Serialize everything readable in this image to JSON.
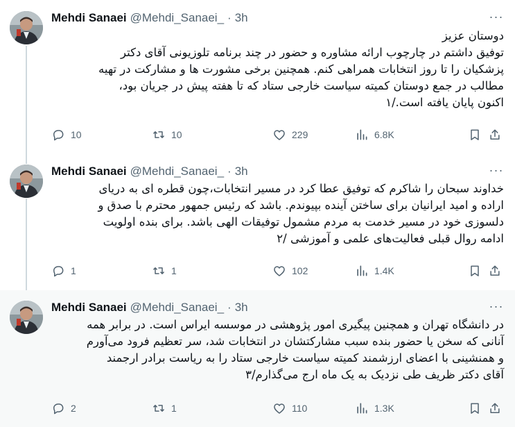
{
  "tweets": [
    {
      "author": {
        "name": "Mehdi Sanaei",
        "handle": "@Mehdi_Sanaei_",
        "separator": "·",
        "time": "3h"
      },
      "lines": [
        "دوستان عزیز",
        "توفیق داشتم در چارچوب ارائه مشاوره و حضور در چند برنامه تلوزیونی آقای دکتر",
        "پزشکیان را تا روز انتخابات همراهی کنم.  همچنین برخی مشورت ها و مشارکت در تهیه",
        "مطالب در جمع دوستان کمیته سیاست خارجی ستاد که  تا هفته پیش در جریان بود،",
        "اکنون پایان یافته است./۱"
      ],
      "stats": {
        "replies": "10",
        "retweets": "10",
        "likes": "229",
        "views": "6.8K"
      }
    },
    {
      "author": {
        "name": "Mehdi Sanaei",
        "handle": "@Mehdi_Sanaei_",
        "separator": "·",
        "time": "3h"
      },
      "lines": [
        "خداوند سبحان را شاکرم که توفیق عطا کرد در مسیر انتخابات،چون قطره ای به دریای",
        "اراده و امید ایرانیان برای ساختن آینده بپیوندم. باشد که رئیس جمهور محترم با صدق و",
        "دلسوزی خود در مسیر خدمت به مردم مشمول توفیقات الهی باشد. برای بنده اولویت",
        "ادامه روال قبلی فعالیت‌های علمی و آموزشی /۲"
      ],
      "stats": {
        "replies": "1",
        "retweets": "1",
        "likes": "102",
        "views": "1.4K"
      }
    },
    {
      "author": {
        "name": "Mehdi Sanaei",
        "handle": "@Mehdi_Sanaei_",
        "separator": "·",
        "time": "3h"
      },
      "lines": [
        "در دانشگاه تهران و همچنین پیگیری امور پژوهشی در موسسه ایراس است.  در برابر همه",
        "آنانی که سخن یا حضور بنده سبب مشارکتشان در انتخابات شد، سر تعظیم فرود می‌آورم",
        "و همنشینی با اعضای ارزشمند کمیته سیاست خارجی ستاد را به ریاست برادر ارجمند",
        "آقای دکتر ظریف طی نزدیک به یک ماه ارج می‌گذارم/۳"
      ],
      "stats": {
        "replies": "2",
        "retweets": "1",
        "likes": "110",
        "views": "1.3K"
      }
    }
  ],
  "icons": {
    "more": "more-options-icon",
    "reply": "reply-icon",
    "retweet": "retweet-icon",
    "like": "like-icon",
    "views": "views-icon",
    "bookmark": "bookmark-icon",
    "share": "share-icon"
  },
  "colors": {
    "text": "#0f1419",
    "muted": "#536471",
    "thread_line": "#cfd9de",
    "highlight_bg": "#f7f9f9"
  }
}
